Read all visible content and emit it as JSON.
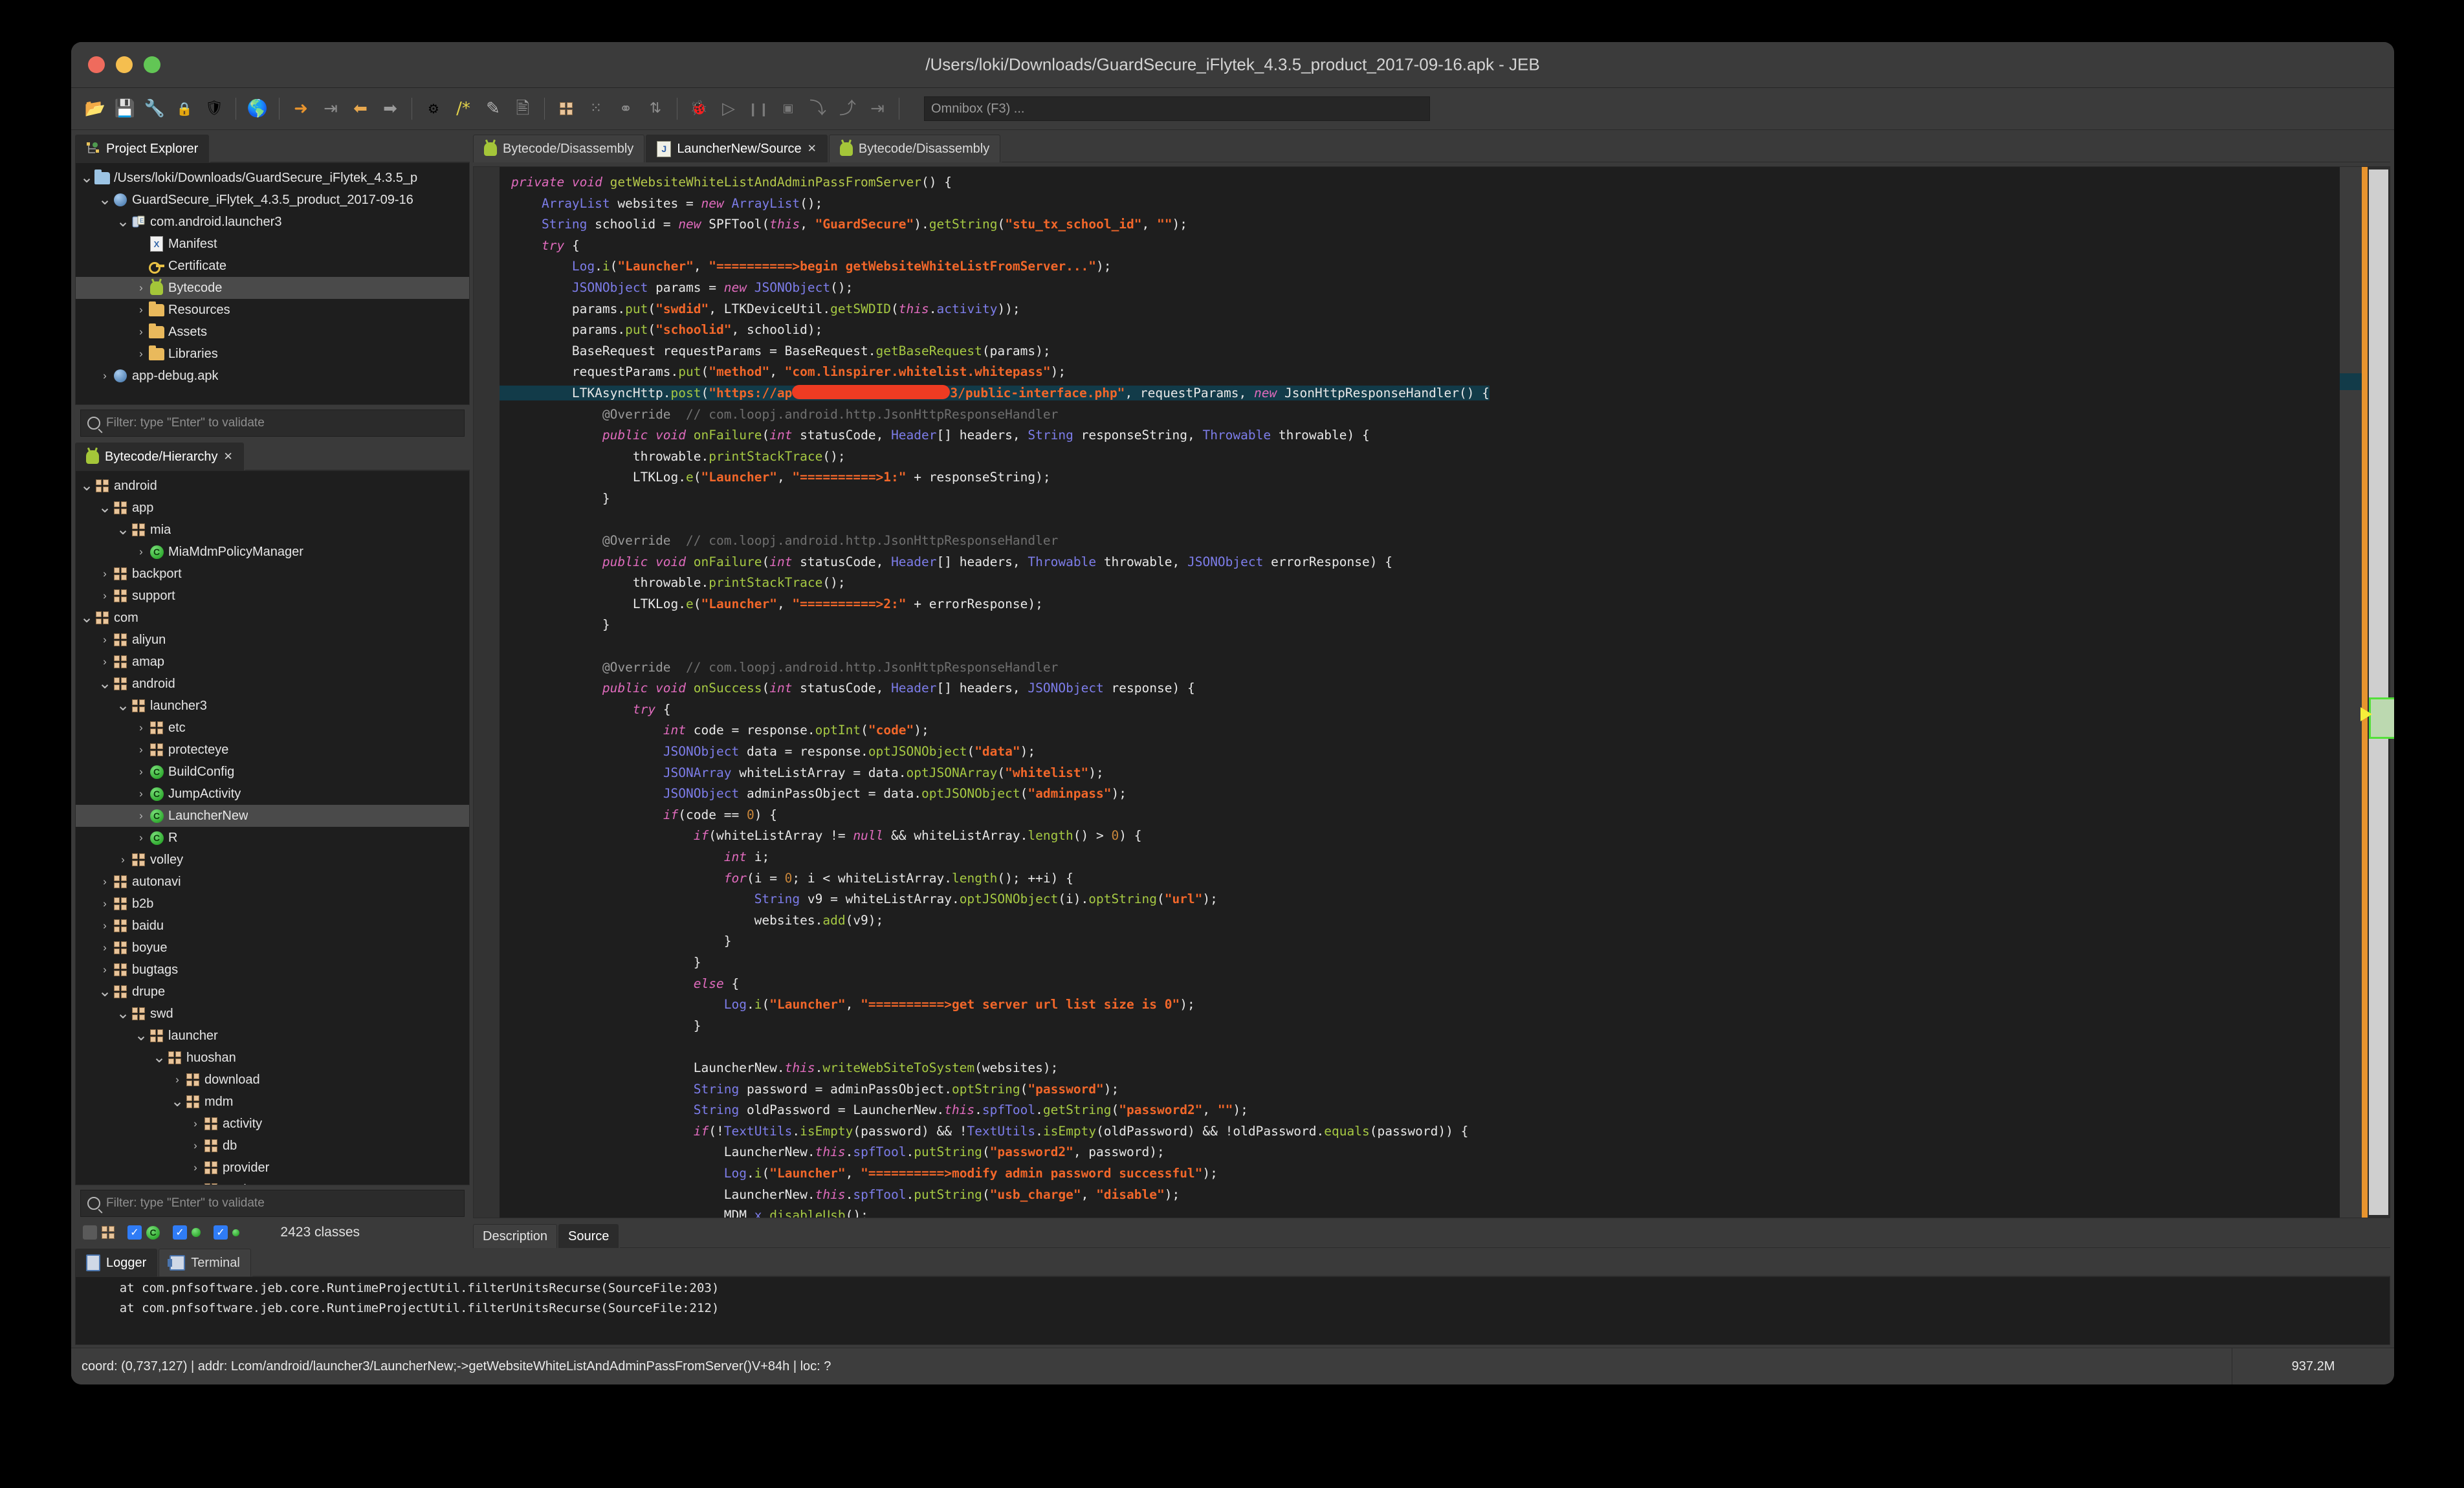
{
  "window": {
    "title": "/Users/loki/Downloads/GuardSecure_iFlytek_4.3.5_product_2017-09-16.apk - JEB"
  },
  "toolbar": {
    "icons": [
      "open-folder-icon",
      "save-icon",
      "wrench-icon",
      "lock-icon",
      "shield-icon",
      "globe-icon",
      "jump-to-icon",
      "export-icon",
      "back-arrow-icon",
      "forward-arrow-icon",
      "refactor-icon",
      "comment-icon",
      "rename-icon",
      "save-as-icon",
      "package-icon",
      "decompile-icon",
      "graph-icon",
      "sort-icon",
      "debug-bug-icon",
      "run-icon",
      "pause-icon",
      "stop-icon",
      "step-over-icon",
      "step-back-icon",
      "step-into-icon"
    ],
    "omnibox_placeholder": "Omnibox (F3) ..."
  },
  "project_explorer": {
    "tab_label": "Project Explorer",
    "tab_icon": "project-explorer-icon",
    "rows": [
      {
        "depth": 0,
        "arrow": "v",
        "icon": "folder-open-icon",
        "label": "/Users/loki/Downloads/GuardSecure_iFlytek_4.3.5_p",
        "sel": false
      },
      {
        "depth": 1,
        "arrow": "v",
        "icon": "apk-sphere-icon",
        "label": "GuardSecure_iFlytek_4.3.5_product_2017-09-16",
        "sel": false
      },
      {
        "depth": 2,
        "arrow": "v",
        "icon": "dex-icon",
        "label": "com.android.launcher3",
        "sel": false
      },
      {
        "depth": 3,
        "arrow": "",
        "icon": "xml-manifest-icon",
        "label": "Manifest",
        "sel": false
      },
      {
        "depth": 3,
        "arrow": "",
        "icon": "key-certificate-icon",
        "label": "Certificate",
        "sel": false
      },
      {
        "depth": 3,
        "arrow": ">",
        "icon": "android-bytecode-icon",
        "label": "Bytecode",
        "sel": true
      },
      {
        "depth": 3,
        "arrow": ">",
        "icon": "folder-icon",
        "label": "Resources",
        "sel": false
      },
      {
        "depth": 3,
        "arrow": ">",
        "icon": "folder-icon",
        "label": "Assets",
        "sel": false
      },
      {
        "depth": 3,
        "arrow": ">",
        "icon": "folder-icon",
        "label": "Libraries",
        "sel": false
      },
      {
        "depth": 1,
        "arrow": ">",
        "icon": "apk-sphere-icon",
        "label": "app-debug.apk",
        "sel": false
      }
    ],
    "filter_placeholder": "Filter: type \"Enter\" to validate"
  },
  "hierarchy": {
    "tab_label": "Bytecode/Hierarchy",
    "tab_icon": "android-icon",
    "tab_close_icon": "close-icon",
    "rows": [
      {
        "depth": 0,
        "arrow": "v",
        "icon": "package-icon",
        "label": "android",
        "sel": false
      },
      {
        "depth": 1,
        "arrow": "v",
        "icon": "package-icon",
        "label": "app",
        "sel": false
      },
      {
        "depth": 2,
        "arrow": "v",
        "icon": "package-icon",
        "label": "mia",
        "sel": false
      },
      {
        "depth": 3,
        "arrow": ">",
        "icon": "class-icon",
        "label": "MiaMdmPolicyManager",
        "sel": false
      },
      {
        "depth": 1,
        "arrow": ">",
        "icon": "package-icon",
        "label": "backport",
        "sel": false
      },
      {
        "depth": 1,
        "arrow": ">",
        "icon": "package-icon",
        "label": "support",
        "sel": false
      },
      {
        "depth": 0,
        "arrow": "v",
        "icon": "package-icon",
        "label": "com",
        "sel": false
      },
      {
        "depth": 1,
        "arrow": ">",
        "icon": "package-icon",
        "label": "aliyun",
        "sel": false
      },
      {
        "depth": 1,
        "arrow": ">",
        "icon": "package-icon",
        "label": "amap",
        "sel": false
      },
      {
        "depth": 1,
        "arrow": "v",
        "icon": "package-icon",
        "label": "android",
        "sel": false
      },
      {
        "depth": 2,
        "arrow": "v",
        "icon": "package-icon",
        "label": "launcher3",
        "sel": false
      },
      {
        "depth": 3,
        "arrow": ">",
        "icon": "package-icon",
        "label": "etc",
        "sel": false
      },
      {
        "depth": 3,
        "arrow": ">",
        "icon": "package-icon",
        "label": "protecteye",
        "sel": false
      },
      {
        "depth": 3,
        "arrow": ">",
        "icon": "class-icon",
        "label": "BuildConfig",
        "sel": false
      },
      {
        "depth": 3,
        "arrow": ">",
        "icon": "class-icon",
        "label": "JumpActivity",
        "sel": false
      },
      {
        "depth": 3,
        "arrow": ">",
        "icon": "class-icon",
        "label": "LauncherNew",
        "sel": true
      },
      {
        "depth": 3,
        "arrow": ">",
        "icon": "class-icon",
        "label": "R",
        "sel": false
      },
      {
        "depth": 2,
        "arrow": ">",
        "icon": "package-icon",
        "label": "volley",
        "sel": false
      },
      {
        "depth": 1,
        "arrow": ">",
        "icon": "package-icon",
        "label": "autonavi",
        "sel": false
      },
      {
        "depth": 1,
        "arrow": ">",
        "icon": "package-icon",
        "label": "b2b",
        "sel": false
      },
      {
        "depth": 1,
        "arrow": ">",
        "icon": "package-icon",
        "label": "baidu",
        "sel": false
      },
      {
        "depth": 1,
        "arrow": ">",
        "icon": "package-icon",
        "label": "boyue",
        "sel": false
      },
      {
        "depth": 1,
        "arrow": ">",
        "icon": "package-icon",
        "label": "bugtags",
        "sel": false
      },
      {
        "depth": 1,
        "arrow": "v",
        "icon": "package-icon",
        "label": "drupe",
        "sel": false
      },
      {
        "depth": 2,
        "arrow": "v",
        "icon": "package-icon",
        "label": "swd",
        "sel": false
      },
      {
        "depth": 3,
        "arrow": "v",
        "icon": "package-icon",
        "label": "launcher",
        "sel": false
      },
      {
        "depth": 4,
        "arrow": "v",
        "icon": "package-icon",
        "label": "huoshan",
        "sel": false
      },
      {
        "depth": 5,
        "arrow": ">",
        "icon": "package-icon",
        "label": "download",
        "sel": false
      },
      {
        "depth": 5,
        "arrow": "v",
        "icon": "package-icon",
        "label": "mdm",
        "sel": false
      },
      {
        "depth": 6,
        "arrow": ">",
        "icon": "package-icon",
        "label": "activity",
        "sel": false
      },
      {
        "depth": 6,
        "arrow": ">",
        "icon": "package-icon",
        "label": "db",
        "sel": false
      },
      {
        "depth": 6,
        "arrow": ">",
        "icon": "package-icon",
        "label": "provider",
        "sel": false
      },
      {
        "depth": 6,
        "arrow": ">",
        "icon": "package-icon",
        "label": "push",
        "sel": false
      }
    ],
    "filter_placeholder": "Filter: type \"Enter\" to validate",
    "toggles": [
      {
        "checked": false,
        "icon": "package-icon"
      },
      {
        "checked": true,
        "icon": "class-icon"
      },
      {
        "checked": true,
        "icon": "method-icon"
      },
      {
        "checked": true,
        "icon": "field-icon"
      }
    ],
    "class_count": "2423 classes"
  },
  "editor": {
    "tabs": [
      {
        "label": "Bytecode/Disassembly",
        "icon": "android-icon",
        "active": false,
        "closable": false
      },
      {
        "label": "LauncherNew/Source",
        "icon": "java-source-icon",
        "active": true,
        "closable": true
      },
      {
        "label": "Bytecode/Disassembly",
        "icon": "android-icon",
        "active": false,
        "closable": false
      }
    ],
    "sub_tabs": [
      {
        "label": "Description",
        "active": false
      },
      {
        "label": "Source",
        "active": true
      }
    ],
    "redaction_note": "url-redacted-overlay"
  },
  "bottom": {
    "tabs": [
      {
        "label": "Logger",
        "icon": "logger-icon",
        "active": true
      },
      {
        "label": "Terminal",
        "icon": "terminal-icon",
        "active": false
      }
    ],
    "lines": [
      "    at com.pnfsoftware.jeb.core.RuntimeProjectUtil.filterUnitsRecurse(SourceFile:203)",
      "    at com.pnfsoftware.jeb.core.RuntimeProjectUtil.filterUnitsRecurse(SourceFile:212)"
    ]
  },
  "status": {
    "left": "coord: (0,737,127) | addr: Lcom/android/launcher3/LauncherNew;->getWebsiteWhiteListAndAdminPassFromServer()V+84h | loc: ?",
    "memory": "937.2M"
  },
  "colors": {
    "accent_orange": "#e8942e",
    "string": "#f2672a",
    "keyword": "#e06bbd",
    "type": "#7d7dea",
    "method": "#a6c943",
    "comment": "#6f6f6f",
    "highlight_line": "#123b49",
    "redaction": "#ee3b22"
  }
}
